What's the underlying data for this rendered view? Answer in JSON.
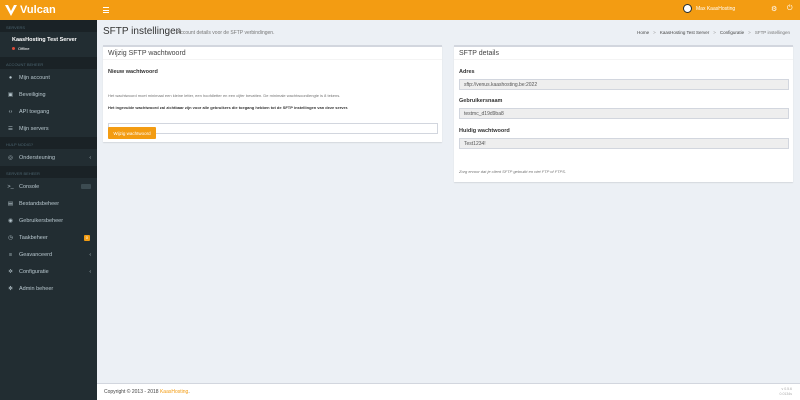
{
  "brand": {
    "name": "Vulcan"
  },
  "sidebar": {
    "section_server": "Servers",
    "server_name": "KaasHosting Test Server",
    "server_status": "Offline",
    "section_account": "Account beheer",
    "section_help": "Hulp nodig?",
    "section_server_beheer": "Server beheer",
    "items_account": [
      {
        "label": "Mijn account",
        "icon": "user-icon"
      },
      {
        "label": "Beveiliging",
        "icon": "lock-icon"
      },
      {
        "label": "API toegang",
        "icon": "code-icon"
      },
      {
        "label": "Mijn servers",
        "icon": "server-icon"
      }
    ],
    "items_help": [
      {
        "label": "Ondersteuning",
        "icon": "lifebuoy-icon"
      }
    ],
    "items_server": [
      {
        "label": "Console",
        "icon": "terminal-icon"
      },
      {
        "label": "Bestandsbeheer",
        "icon": "file-icon"
      },
      {
        "label": "Gebruikersbeheer",
        "icon": "users-icon"
      },
      {
        "label": "Taakbeheer",
        "icon": "clock-icon",
        "badge": "0"
      },
      {
        "label": "Geavanceerd",
        "icon": "sliders-icon"
      },
      {
        "label": "Configuratie",
        "icon": "gears-icon"
      },
      {
        "label": "Admin beheer",
        "icon": "cog-icon"
      }
    ]
  },
  "header": {
    "user_name": "Max KaasHosting",
    "accent": "#f39c12"
  },
  "page": {
    "title": "SFTP instellingen",
    "subtitle": "Account details voor de SFTP verbindingen.",
    "breadcrumb": [
      "Home",
      "KaasHosting Test Server",
      "Configuratie",
      "SFTP instellingen"
    ]
  },
  "password_box": {
    "title": "Wijzig SFTP wachtwoord",
    "label": "Nieuw wachtwoord",
    "value": "",
    "help": "Het wachtwoord moet minimaal een kleine letter, een hoofdletter en een cijfer bevatten. De minimale wachtwoordlengte is 8 tekens.",
    "note": "Het ingevulde wachtwoord zal zichtbaar zijn voor alle gebruikers die toegang hebben tot de SFTP instellingen van deze server.",
    "button": "Wijzig wachtwoord"
  },
  "details_box": {
    "title": "SFTP details",
    "address_label": "Adres",
    "address_value": "sftp://venus.kaashosting.be:2022",
    "username_label": "Gebruikersnaam",
    "username_value": "testmc_d19d9ba8",
    "current_pw_label": "Huidig wachtwoord",
    "current_pw_value": "Test1234!",
    "hint": "Zorg ervoor dat je client SFTP gebruikt en niet FTP of FTPS."
  },
  "footer": {
    "copyright": "Copyright © 2013 - 2018",
    "company": "KaasHosting",
    "version_line1": "v 0.5.6",
    "version_line2": "0.0134s"
  }
}
